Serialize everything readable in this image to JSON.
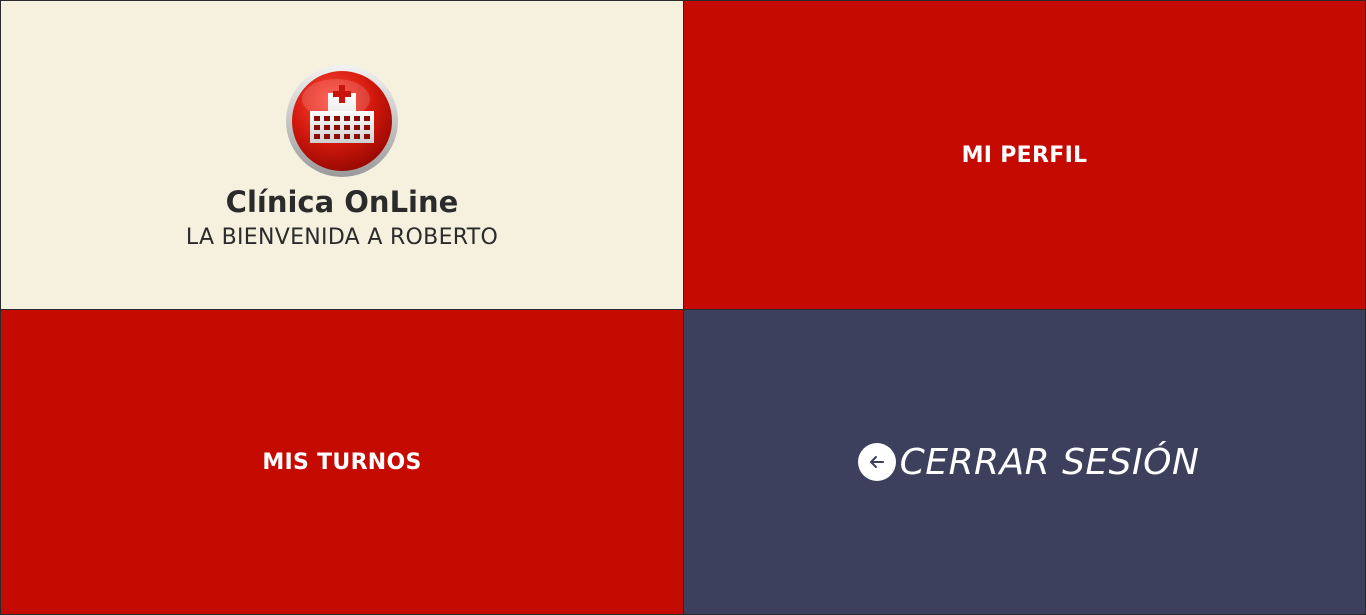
{
  "brand": {
    "title": "Clínica OnLine",
    "welcome": "LA BIENVENIDA A ROBERTO",
    "logo_icon": "hospital-icon"
  },
  "tiles": {
    "profile_label": "MI PERFIL",
    "appointments_label": "MIS TURNOS",
    "logout_label": "CERRAR SESIÓN",
    "logout_icon": "arrow-left-circle-icon"
  },
  "colors": {
    "beige": "#f5f1de",
    "red": "#c50a02",
    "slate": "#3c405c"
  }
}
